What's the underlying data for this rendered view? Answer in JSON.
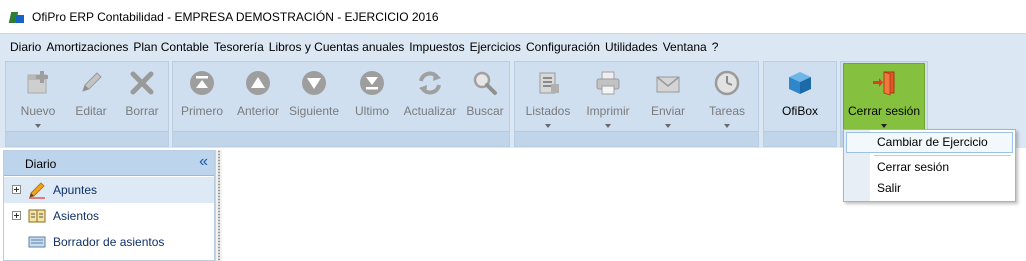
{
  "window": {
    "title": "OfiPro ERP Contabilidad - EMPRESA DEMOSTRACIÓN - EJERCICIO 2016",
    "icon": "ofipro-app-icon"
  },
  "menu": {
    "items": [
      "Diario",
      "Amortizaciones",
      "Plan Contable",
      "Tesorería",
      "Libros y Cuentas anuales",
      "Impuestos",
      "Ejercicios",
      "Configuración",
      "Utilidades",
      "Ventana",
      "?"
    ]
  },
  "ribbon": {
    "edit_group": {
      "nuevo": "Nuevo",
      "editar": "Editar",
      "borrar": "Borrar"
    },
    "nav_group": {
      "primero": "Primero",
      "anterior": "Anterior",
      "siguiente": "Siguiente",
      "ultimo": "Ultimo",
      "actualizar": "Actualizar",
      "buscar": "Buscar"
    },
    "output_group": {
      "listados": "Listados",
      "imprimir": "Imprimir",
      "enviar": "Enviar",
      "tareas": "Tareas"
    },
    "ofibox_group": {
      "ofibox": "OfiBox"
    },
    "session_group": {
      "cerrar_sesion": "Cerrar sesión"
    }
  },
  "dropdown": {
    "cambiar_ejercicio": "Cambiar de Ejercicio",
    "cerrar_sesion": "Cerrar sesión",
    "salir": "Salir"
  },
  "panel": {
    "title": "Diario",
    "collapse_glyph": "«",
    "items": [
      {
        "label": "Apuntes",
        "icon": "pencil-icon"
      },
      {
        "label": "Asientos",
        "icon": "ledger-icon"
      },
      {
        "label": "Borrador de asientos",
        "icon": "draft-icon"
      }
    ]
  },
  "colors": {
    "ribbon_bg": "#dbe7f3",
    "active_button": "#86c03f",
    "panel_header": "#bcd4ec"
  }
}
